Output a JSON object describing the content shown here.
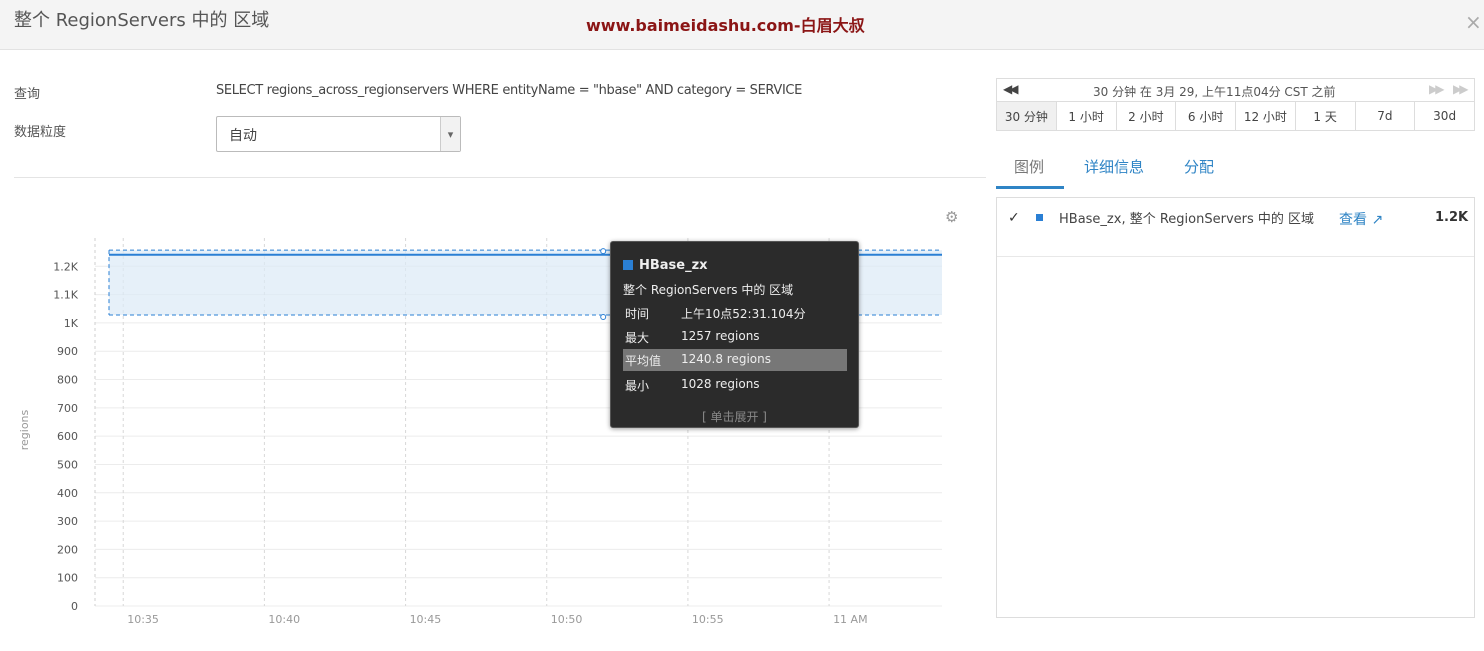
{
  "header": {
    "title": "整个 RegionServers 中的 区域",
    "watermark": "www.baimeidashu.com-白眉大叔",
    "close_icon": "close-icon"
  },
  "query": {
    "label": "查询",
    "text": "SELECT regions_across_regionservers WHERE entityName = \"hbase\" AND category = SERVICE"
  },
  "granularity": {
    "label": "数据粒度",
    "value": "自动"
  },
  "time_range": {
    "description": "30 分钟 在 3月 29, 上午11点04分 CST 之前",
    "buttons": [
      "30 分钟",
      "1 小时",
      "2 小时",
      "6 小时",
      "12 小时",
      "1 天",
      "7d",
      "30d"
    ],
    "active_index": 0
  },
  "tabs": [
    "图例",
    "详细信息",
    "分配"
  ],
  "legend": {
    "check": "✓",
    "label": "HBase_zx, 整个 RegionServers 中的 区域",
    "view_label": "查看",
    "value": "1.2K"
  },
  "tooltip": {
    "series": "HBase_zx",
    "metric": "整个 RegionServers 中的 区域",
    "rows": [
      {
        "key": "时间",
        "value": "上午10点52:31.104分"
      },
      {
        "key": "最大",
        "value": "1257 regions"
      },
      {
        "key": "平均值",
        "value": "1240.8 regions"
      },
      {
        "key": "最小",
        "value": "1028 regions"
      }
    ],
    "expand": "[ 单击展开 ]"
  },
  "colors": {
    "series": "#2a7fd4",
    "band": "#dce9f6",
    "link": "#2f84c5",
    "watermark": "#8b1515"
  },
  "chart_data": {
    "type": "line",
    "ylabel": "regions",
    "y_ticks": [
      "0",
      "100",
      "200",
      "300",
      "400",
      "500",
      "600",
      "700",
      "800",
      "900",
      "1K",
      "1.1K",
      "1.2K"
    ],
    "x_ticks": [
      "10:35",
      "10:40",
      "10:45",
      "10:50",
      "10:55",
      "11 AM"
    ],
    "ylim": [
      0,
      1300
    ],
    "series": [
      {
        "name": "HBase_zx",
        "x": [
          "10:34",
          "11:04"
        ],
        "values": [
          1240.8,
          1240.8
        ],
        "max": [
          1257,
          1257
        ],
        "min": [
          1028,
          1028
        ]
      }
    ],
    "grid": true
  }
}
